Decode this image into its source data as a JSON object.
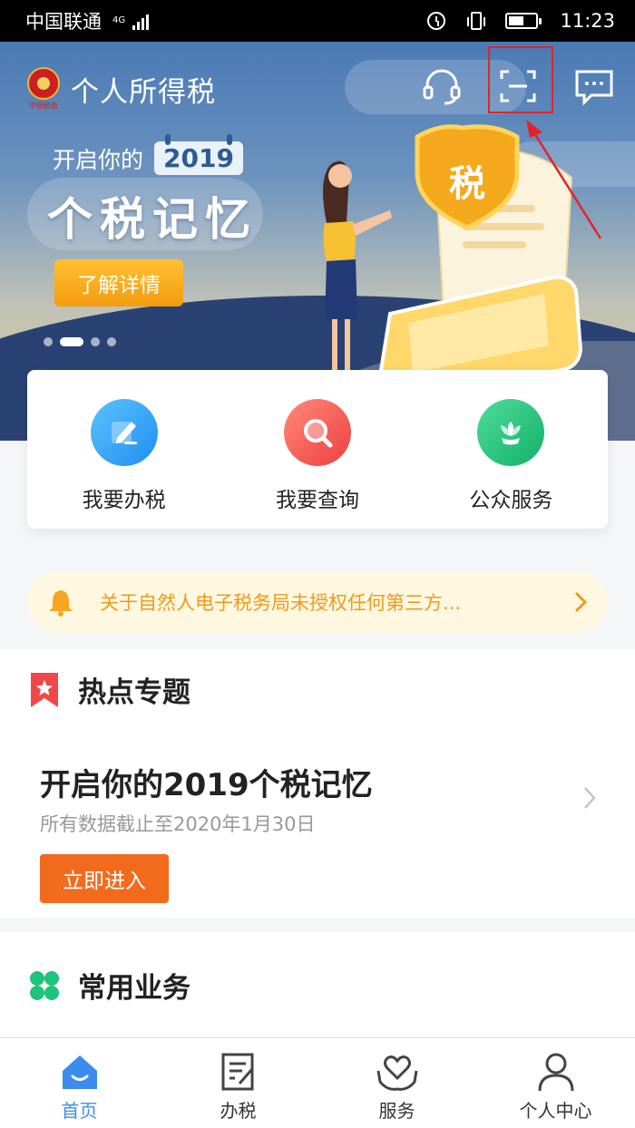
{
  "status_bar": {
    "carrier": "中国联通",
    "network": "4G",
    "time": "11:23",
    "battery_level": 0.55
  },
  "header": {
    "app_title": "个人所得税",
    "emblem_text": "中国税务",
    "icons": [
      "headset-icon",
      "scan-icon",
      "message-icon"
    ]
  },
  "banner": {
    "line1": "开启你的",
    "year": "2019",
    "title": "个税记忆",
    "cta_label": "了解详情",
    "tax_badge": "税",
    "slide_count": 4,
    "active_slide": 2
  },
  "quick_actions": [
    {
      "label": "我要办税",
      "color": "#2ea3f2",
      "icon": "pen-icon"
    },
    {
      "label": "我要查询",
      "color": "#f2544b",
      "icon": "search-icon"
    },
    {
      "label": "公众服务",
      "color": "#25c27b",
      "icon": "flower-icon"
    }
  ],
  "notice": {
    "text": "关于自然人电子税务局未授权任何第三方..."
  },
  "hot_topics": {
    "title": "热点专题",
    "item_title": "开启你的2019个税记忆",
    "item_sub": "所有数据截止至2020年1月30日",
    "button_label": "立即进入"
  },
  "common_services": {
    "title": "常用业务"
  },
  "tabs": [
    {
      "label": "首页",
      "icon": "home-icon",
      "active": true
    },
    {
      "label": "办税",
      "icon": "document-icon",
      "active": false
    },
    {
      "label": "服务",
      "icon": "heart-hands-icon",
      "active": false
    },
    {
      "label": "个人中心",
      "icon": "person-icon",
      "active": false
    }
  ],
  "colors": {
    "accent": "#3a8dee",
    "orange": "#f26b1d",
    "notice_text": "#f19a1b",
    "highlight_box": "#e2242a"
  }
}
